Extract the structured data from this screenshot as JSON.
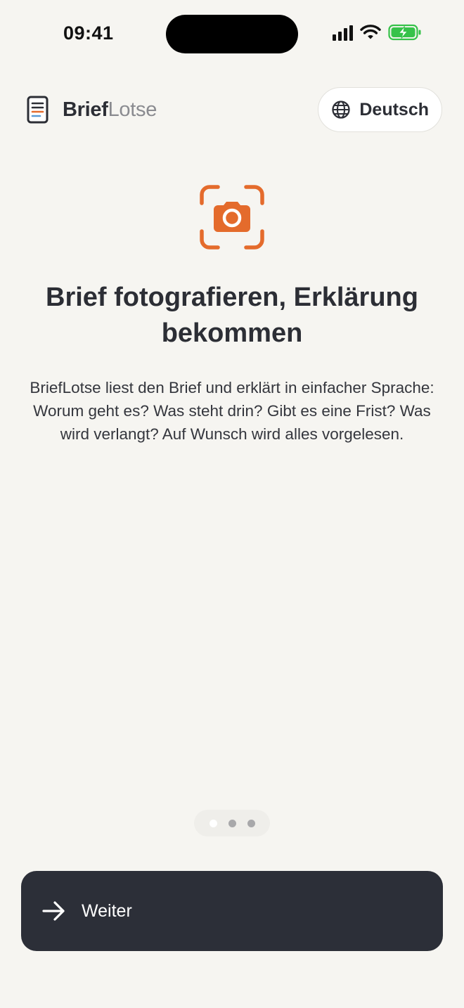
{
  "status_bar": {
    "time": "09:41",
    "icons": [
      "signal-icon",
      "wifi-icon",
      "battery-charging-icon"
    ]
  },
  "header": {
    "brand_bold": "Brief",
    "brand_light": "Lotse",
    "logo_icon": "document-icon",
    "language_label": "Deutsch",
    "language_icon": "globe-icon"
  },
  "hero": {
    "icon": "camera-scan-icon",
    "accent_color": "#E46B2C",
    "title": "Brief fotografieren, Erklärung bekommen",
    "description": "BriefLotse liest den Brief und erklärt in einfacher Sprache: Worum geht es? Was steht drin? Gibt es eine Frist? Was wird verlangt? Auf Wunsch wird alles vorgelesen."
  },
  "pagination": {
    "total": 3,
    "current": 1
  },
  "primary_action": {
    "label": "Weiter",
    "icon": "arrow-right-icon",
    "background_color": "#2C2F38"
  },
  "colors": {
    "background": "#F6F5F1",
    "text": "#2C2E35"
  }
}
